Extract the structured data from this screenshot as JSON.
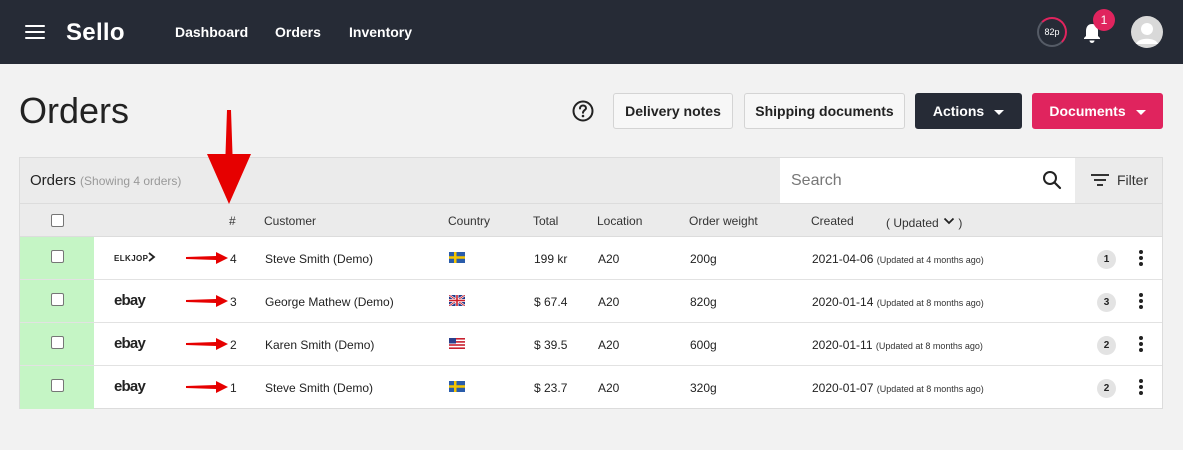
{
  "nav": {
    "brand": "Sello",
    "links": [
      "Dashboard",
      "Orders",
      "Inventory"
    ],
    "score": "82p",
    "notifications": "1"
  },
  "page": {
    "title": "Orders",
    "buttons": {
      "delivery_notes": "Delivery notes",
      "shipping_documents": "Shipping documents",
      "actions": "Actions",
      "documents": "Documents"
    }
  },
  "toolbar": {
    "title": "Orders",
    "subtitle": "(Showing 4 orders)",
    "search_placeholder": "Search",
    "filter": "Filter"
  },
  "columns": {
    "number": "#",
    "customer": "Customer",
    "country": "Country",
    "total": "Total",
    "location": "Location",
    "weight": "Order weight",
    "created": "Created",
    "updated": "( Updated",
    "updated_close": ")"
  },
  "orders": [
    {
      "channel": "ELKJOP",
      "number": "4",
      "customer": "Steve Smith (Demo)",
      "flag": "se",
      "total": "199 kr",
      "location": "A20",
      "weight": "200g",
      "created": "2021-04-06",
      "updated": "(Updated at 4 months ago)",
      "count": "1"
    },
    {
      "channel": "ebay",
      "number": "3",
      "customer": "George Mathew (Demo)",
      "flag": "gb",
      "total": "$ 67.4",
      "location": "A20",
      "weight": "820g",
      "created": "2020-01-14",
      "updated": "(Updated at 8 months ago)",
      "count": "3"
    },
    {
      "channel": "ebay",
      "number": "2",
      "customer": "Karen Smith (Demo)",
      "flag": "us",
      "total": "$ 39.5",
      "location": "A20",
      "weight": "600g",
      "created": "2020-01-11",
      "updated": "(Updated at 8 months ago)",
      "count": "2"
    },
    {
      "channel": "ebay",
      "number": "1",
      "customer": "Steve Smith (Demo)",
      "flag": "se",
      "total": "$ 23.7",
      "location": "A20",
      "weight": "320g",
      "created": "2020-01-07",
      "updated": "(Updated at 8 months ago)",
      "count": "2"
    }
  ],
  "colors": {
    "topbar": "#262b36",
    "accent": "#e0245e",
    "stripe": "#c5f5c5",
    "annotation_arrow": "#e60000"
  }
}
